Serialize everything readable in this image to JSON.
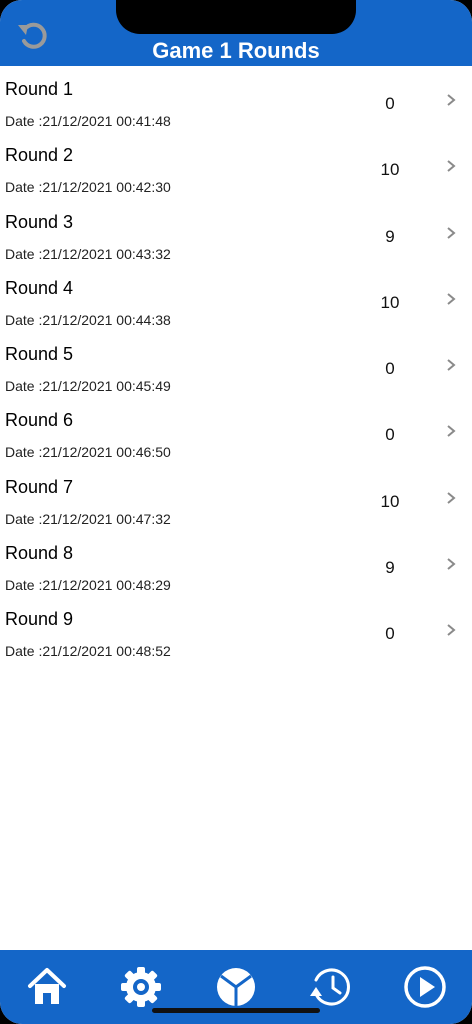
{
  "header": {
    "title": "Game 1 Rounds",
    "refresh_icon": "refresh-icon"
  },
  "rounds": [
    {
      "name": "Round 1",
      "date": "Date :21/12/2021 00:41:48",
      "score": "0"
    },
    {
      "name": "Round 2",
      "date": "Date :21/12/2021 00:42:30",
      "score": "10"
    },
    {
      "name": "Round 3",
      "date": "Date :21/12/2021 00:43:32",
      "score": "9"
    },
    {
      "name": "Round 4",
      "date": "Date :21/12/2021 00:44:38",
      "score": "10"
    },
    {
      "name": "Round 5",
      "date": "Date :21/12/2021 00:45:49",
      "score": "0"
    },
    {
      "name": "Round 6",
      "date": "Date :21/12/2021 00:46:50",
      "score": "0"
    },
    {
      "name": "Round 7",
      "date": "Date :21/12/2021 00:47:32",
      "score": "10"
    },
    {
      "name": "Round 8",
      "date": "Date :21/12/2021 00:48:29",
      "score": "9"
    },
    {
      "name": "Round 9",
      "date": "Date :21/12/2021 00:48:52",
      "score": "0"
    }
  ],
  "tabbar": {
    "tabs": [
      "home-icon",
      "settings-gear-icon",
      "stats-pie-icon",
      "history-clock-icon",
      "play-icon"
    ]
  },
  "colors": {
    "brand": "#1466c8",
    "chevron": "#8a8a8a"
  }
}
